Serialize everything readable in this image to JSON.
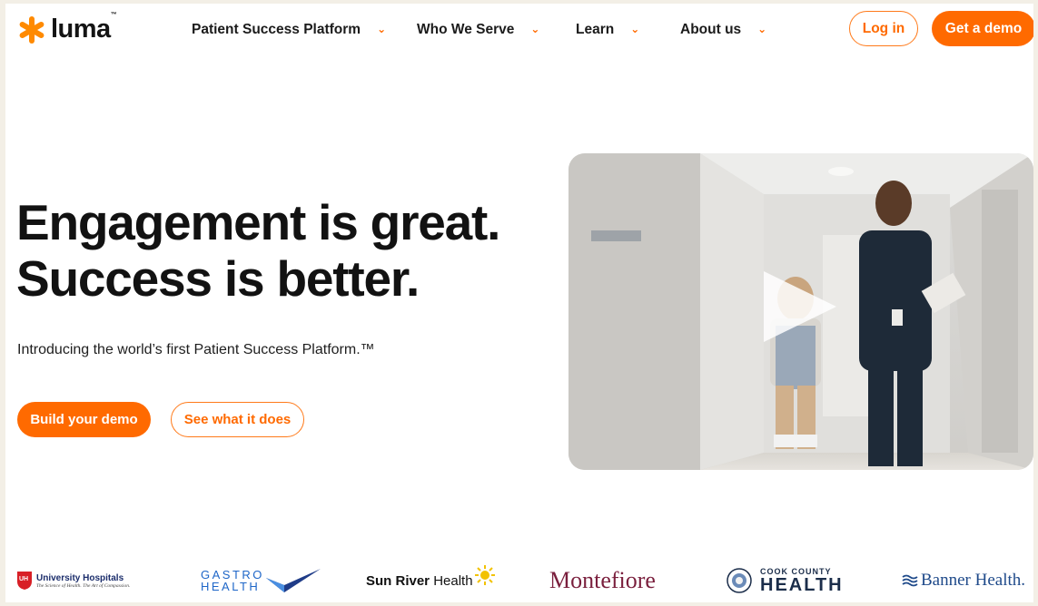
{
  "brand": {
    "name": "luma",
    "trademark": "™",
    "accent": "#ff6a00"
  },
  "nav": {
    "items": [
      {
        "label": "Patient Success Platform",
        "icon": "chevron-down-icon"
      },
      {
        "label": "Who We Serve",
        "icon": "chevron-down-icon"
      },
      {
        "label": "Learn",
        "icon": "chevron-down-icon"
      },
      {
        "label": "About us",
        "icon": "chevron-down-icon"
      }
    ],
    "login_label": "Log in",
    "demo_label": "Get a demo"
  },
  "hero": {
    "headline_line1": "Engagement is great.",
    "headline_line2": "Success is better.",
    "subhead": "Introducing the world’s first Patient Success Platform.™",
    "primary_cta": "Build your demo",
    "secondary_cta": "See what it does",
    "video_icon": "play-icon"
  },
  "customers": {
    "uh_name": "University Hospitals",
    "uh_tagline": "The Science of Health. The Art of Compassion.",
    "gastro_line1": "GASTRO",
    "gastro_line2": "HEALTH",
    "sunriver_bold": "Sun River",
    "sunriver_rest": "Health",
    "montefiore": "Montefiore",
    "cook_line1": "COOK COUNTY",
    "cook_line2": "HEALTH",
    "banner": "Banner Health."
  }
}
